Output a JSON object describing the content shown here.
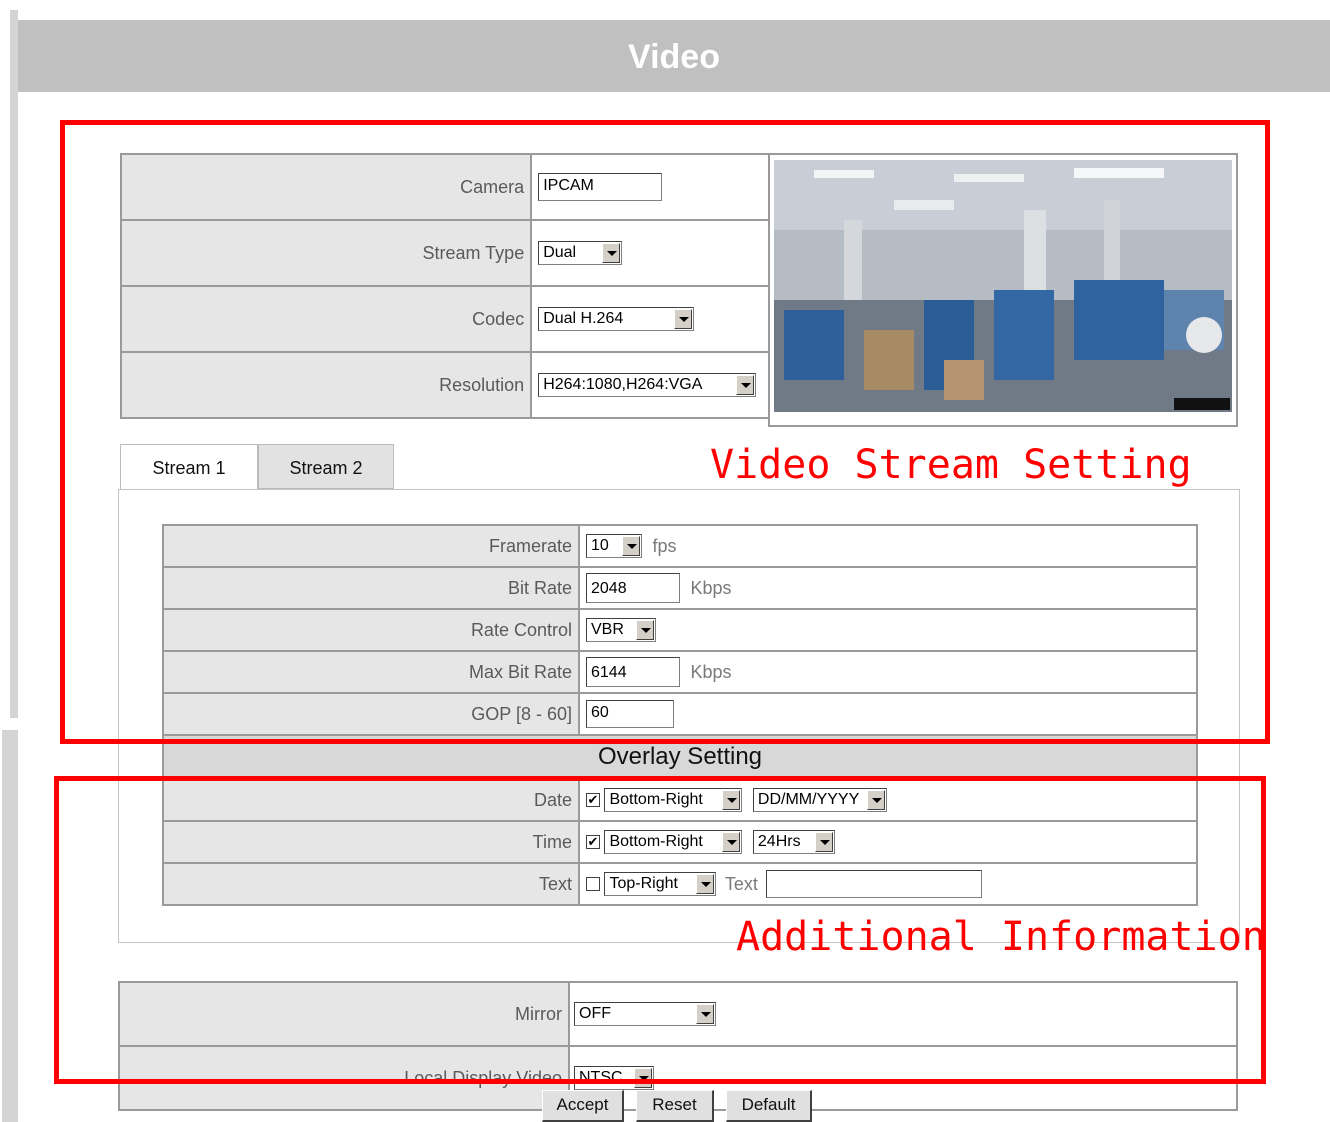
{
  "header": {
    "title": "Video"
  },
  "camera_settings": {
    "camera_label": "Camera",
    "camera_value": "IPCAM",
    "stream_type_label": "Stream Type",
    "stream_type_value": "Dual",
    "codec_label": "Codec",
    "codec_value": "Dual H.264",
    "resolution_label": "Resolution",
    "resolution_value": "H264:1080,H264:VGA"
  },
  "tabs": [
    {
      "label": "Stream 1"
    },
    {
      "label": "Stream 2"
    }
  ],
  "stream": {
    "framerate_label": "Framerate",
    "framerate_value": "10",
    "framerate_unit": "fps",
    "bitrate_label": "Bit Rate",
    "bitrate_value": "2048",
    "bitrate_unit": "Kbps",
    "rate_control_label": "Rate Control",
    "rate_control_value": "VBR",
    "max_bitrate_label": "Max Bit Rate",
    "max_bitrate_value": "6144",
    "max_bitrate_unit": "Kbps",
    "gop_label": "GOP [8 - 60]",
    "gop_value": "60"
  },
  "overlay": {
    "heading": "Overlay Setting",
    "date_label": "Date",
    "date_checked": true,
    "date_position": "Bottom-Right",
    "date_format": "DD/MM/YYYY",
    "time_label": "Time",
    "time_checked": true,
    "time_position": "Bottom-Right",
    "time_format": "24Hrs",
    "text_label": "Text",
    "text_checked": false,
    "text_position": "Top-Right",
    "text_field_label": "Text",
    "text_value": ""
  },
  "misc": {
    "mirror_label": "Mirror",
    "mirror_value": "OFF",
    "local_display_label": "Local Display Video",
    "local_display_value": "NTSC"
  },
  "buttons": {
    "accept": "Accept",
    "reset": "Reset",
    "default": "Default"
  },
  "annotations": {
    "stream_setting": "Video Stream Setting",
    "additional_info": "Additional Information",
    "color": "#ff0000"
  },
  "checkmark": "✔"
}
